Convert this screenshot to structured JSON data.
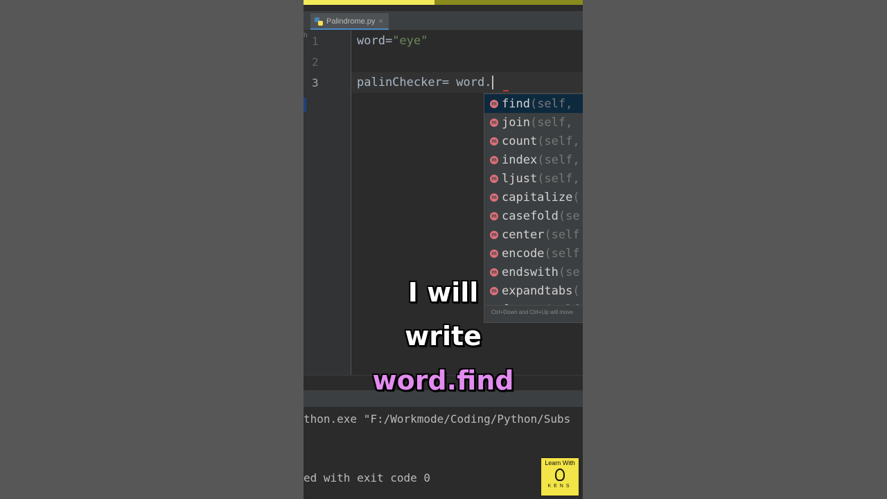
{
  "video": {
    "progress": 0.47
  },
  "editor": {
    "tab": {
      "filename": "Palindrome.py",
      "close_glyph": "×"
    },
    "gutter": {
      "mark": "h"
    },
    "line_numbers": [
      "1",
      "2",
      "3"
    ],
    "lines": {
      "l1_var": "word=",
      "l1_str": "\"eye\"",
      "l3_code": "palinChecker= word."
    }
  },
  "autocomplete": {
    "items": [
      {
        "name": "find",
        "args": "(self,"
      },
      {
        "name": "join",
        "args": "(self,"
      },
      {
        "name": "count",
        "args": "(self,"
      },
      {
        "name": "index",
        "args": "(self,"
      },
      {
        "name": "ljust",
        "args": "(self,"
      },
      {
        "name": "capitalize",
        "args": "("
      },
      {
        "name": "casefold",
        "args": "(se"
      },
      {
        "name": "center",
        "args": "(self"
      },
      {
        "name": "encode",
        "args": "(self"
      },
      {
        "name": "endswith",
        "args": "(se"
      },
      {
        "name": "expandtabs",
        "args": "("
      },
      {
        "name": "format",
        "args": "(self"
      }
    ],
    "icon_letter": "m",
    "hint": "Ctrl+Down and Ctrl+Up will move"
  },
  "run_panel": {
    "command": "thon.exe \"F:/Workmode/Coding/Python/Subs",
    "exit": "ed with exit code 0"
  },
  "captions": {
    "line1": "I will",
    "line2": "write",
    "line3": "word.find"
  },
  "logo": {
    "top": "Learn With",
    "bottom": "KENS"
  }
}
